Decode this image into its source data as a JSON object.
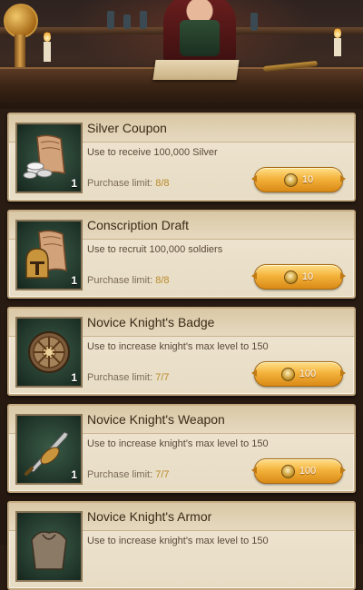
{
  "labels": {
    "purchase_limit": "Purchase limit:"
  },
  "colors": {
    "accent_gold": "#b98a2a",
    "card_bg": "#efe6d3",
    "icon_bg": "#21372b"
  },
  "items": [
    {
      "title": "Silver Coupon",
      "description": "Use to receive 100,000 Silver",
      "limit": "8/8",
      "quantity": "1",
      "price": "10",
      "icon": "silver-coupon-icon"
    },
    {
      "title": "Conscription Draft",
      "description": "Use to recruit 100,000 soldiers",
      "limit": "8/8",
      "quantity": "1",
      "price": "10",
      "icon": "conscription-draft-icon"
    },
    {
      "title": "Novice Knight's Badge",
      "description": "Use to increase knight's max level to 150",
      "limit": "7/7",
      "quantity": "1",
      "price": "100",
      "icon": "knight-badge-icon"
    },
    {
      "title": "Novice Knight's Weapon",
      "description": "Use to increase knight's max level to 150",
      "limit": "7/7",
      "quantity": "1",
      "price": "100",
      "icon": "knight-weapon-icon"
    },
    {
      "title": "Novice Knight's Armor",
      "description": "Use to increase knight's max level to 150",
      "limit": "",
      "quantity": "",
      "price": "",
      "icon": "knight-armor-icon"
    }
  ]
}
